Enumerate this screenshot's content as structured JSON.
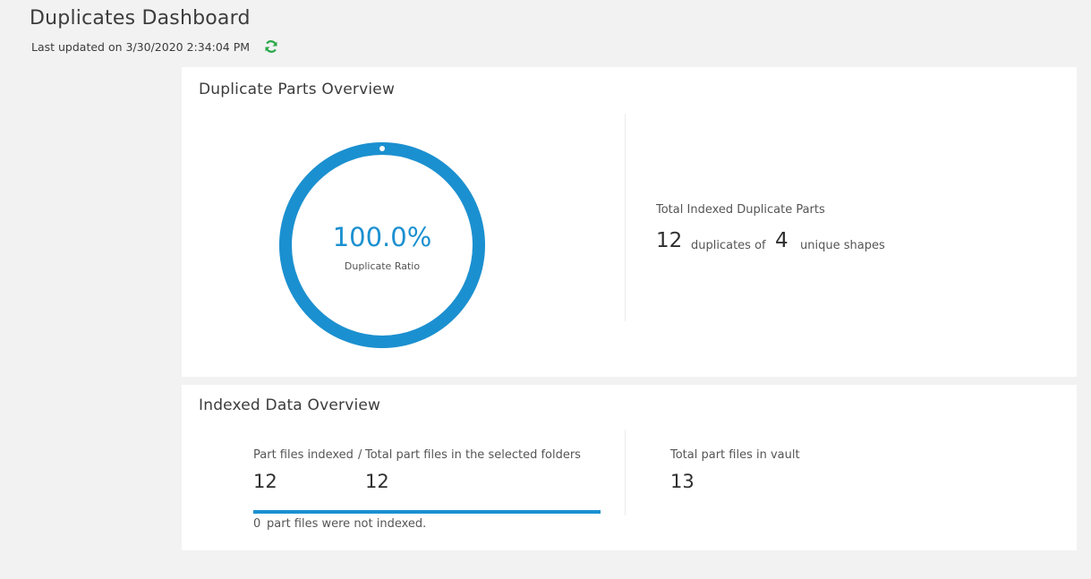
{
  "header": {
    "title": "Duplicates Dashboard",
    "last_updated": "Last updated on 3/30/2020 2:34:04 PM"
  },
  "colors": {
    "accent": "#1b90d0",
    "refresh": "#2aa84a",
    "background": "#f2f2f2"
  },
  "duplicate_overview": {
    "title": "Duplicate Parts Overview",
    "ratio_value": "100.0%",
    "ratio_fraction": 1.0,
    "ratio_label": "Duplicate Ratio",
    "total_label": "Total Indexed Duplicate Parts",
    "duplicates_count": "12",
    "duplicates_of_text": "duplicates of",
    "unique_count": "4",
    "unique_text": "unique shapes"
  },
  "indexed_overview": {
    "title": "Indexed Data Overview",
    "indexed_label": "Part files indexed",
    "separator": "/",
    "selected_label": "Total part files in the selected folders",
    "indexed_count": "12",
    "selected_count": "12",
    "progress_fraction": 1.0,
    "not_indexed_count": "0",
    "not_indexed_text": "part files were not indexed.",
    "vault_label": "Total part files in vault",
    "vault_count": "13"
  }
}
